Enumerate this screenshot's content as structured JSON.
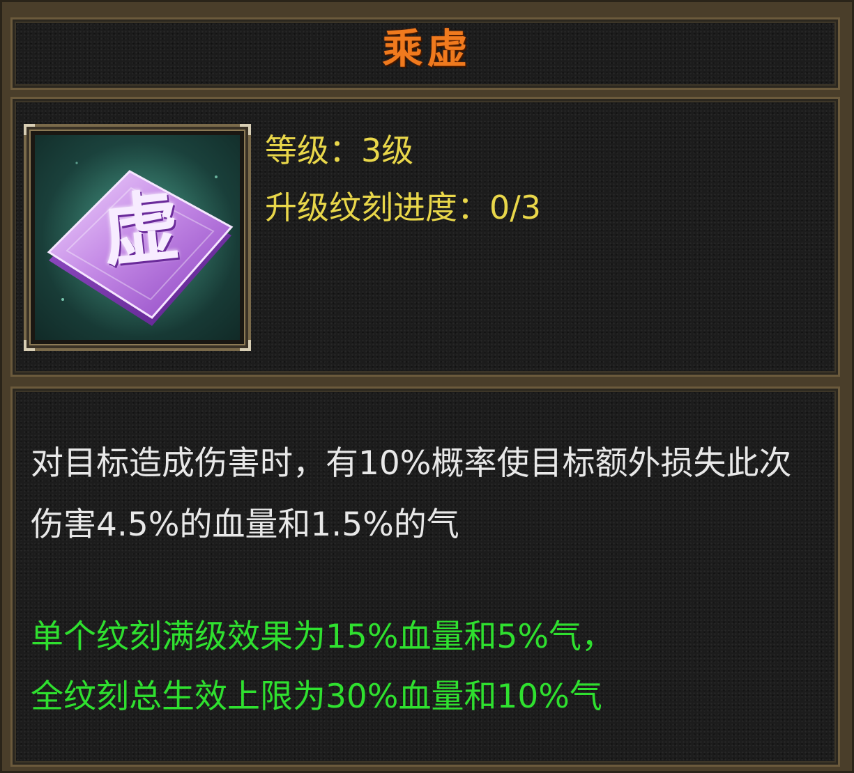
{
  "skill": {
    "name": "乘虚",
    "icon": "xu-rune-icon",
    "icon_glyph": "虚",
    "level_text": "等级：3级",
    "progress_text": "升级纹刻进度：0/3",
    "description": "对目标造成伤害时，有10%概率使目标额外损失此次伤害4.5%的血量和1.5%的气",
    "max_effect_line1": "单个纹刻满级效果为15%血量和5%气，",
    "max_effect_line2": "全纹刻总生效上限为30%血量和10%气"
  },
  "colors": {
    "title": "#f07a1e",
    "stats": "#e9d74a",
    "description": "#e8e8e8",
    "bonus": "#2fe02f"
  }
}
